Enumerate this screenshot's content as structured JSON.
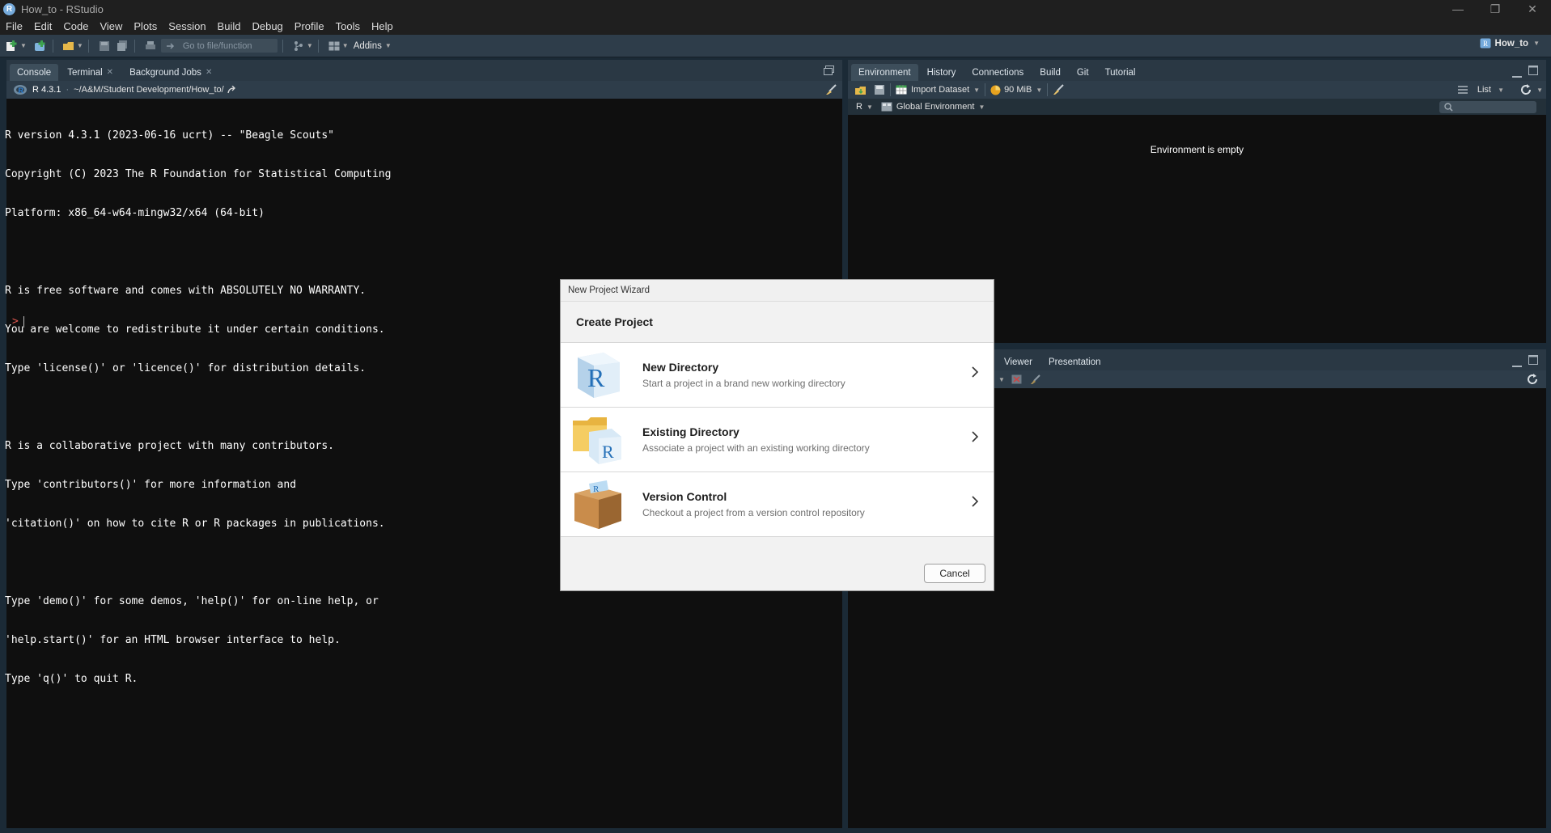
{
  "window": {
    "title": "How_to - RStudio",
    "app_icon_letter": "R"
  },
  "menu": [
    "File",
    "Edit",
    "Code",
    "View",
    "Plots",
    "Session",
    "Build",
    "Debug",
    "Profile",
    "Tools",
    "Help"
  ],
  "toolbar": {
    "goto_placeholder": "Go to file/function",
    "addins_label": "Addins",
    "project_label": "How_to"
  },
  "console_pane": {
    "tabs": [
      {
        "label": "Console",
        "closable": false
      },
      {
        "label": "Terminal",
        "closable": true
      },
      {
        "label": "Background Jobs",
        "closable": true
      }
    ],
    "r_version": "R 4.3.1",
    "path": "~/A&M/Student Development/How_to/",
    "lines": [
      "R version 4.3.1 (2023-06-16 ucrt) -- \"Beagle Scouts\"",
      "Copyright (C) 2023 The R Foundation for Statistical Computing",
      "Platform: x86_64-w64-mingw32/x64 (64-bit)",
      "",
      "R is free software and comes with ABSOLUTELY NO WARRANTY.",
      "You are welcome to redistribute it under certain conditions.",
      "Type 'license()' or 'licence()' for distribution details.",
      "",
      "R is a collaborative project with many contributors.",
      "Type 'contributors()' for more information and",
      "'citation()' on how to cite R or R packages in publications.",
      "",
      "Type 'demo()' for some demos, 'help()' for on-line help, or",
      "'help.start()' for an HTML browser interface to help.",
      "Type 'q()' to quit R."
    ],
    "prompt": ">"
  },
  "env_pane": {
    "tabs": [
      "Environment",
      "History",
      "Connections",
      "Build",
      "Git",
      "Tutorial"
    ],
    "import_label": "Import Dataset",
    "memory_label": "90 MiB",
    "list_label": "List",
    "lang_label": "R",
    "scope_label": "Global Environment",
    "empty_text": "Environment is empty"
  },
  "viewer_pane": {
    "tabs": [
      "Viewer",
      "Presentation"
    ]
  },
  "dialog": {
    "title": "New Project Wizard",
    "heading": "Create Project",
    "options": [
      {
        "title": "New Directory",
        "desc": "Start a project in a brand new working directory",
        "icon": "r-cube-icon"
      },
      {
        "title": "Existing Directory",
        "desc": "Associate a project with an existing working directory",
        "icon": "r-folder-icon"
      },
      {
        "title": "Version Control",
        "desc": "Checkout a project from a version control repository",
        "icon": "package-box-icon"
      }
    ],
    "cancel_label": "Cancel"
  },
  "colors": {
    "accent": "#75aadb",
    "pane_bg": "#0f0f0f",
    "chrome": "#2e3d4a",
    "prompt": "#e0574f"
  }
}
